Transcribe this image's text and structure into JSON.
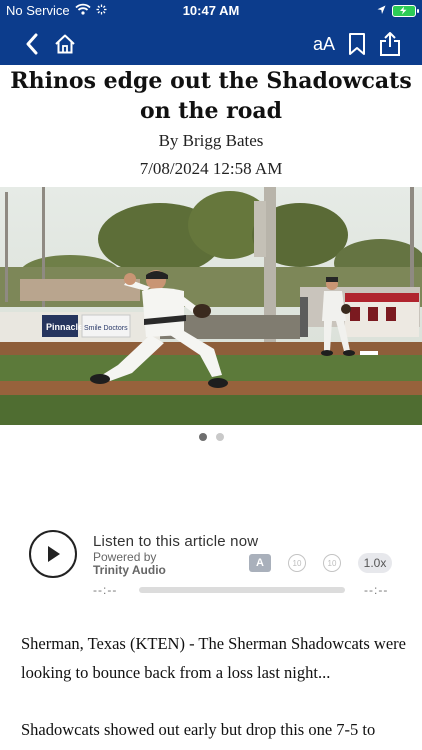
{
  "status_bar": {
    "carrier": "No Service",
    "time": "10:47 AM",
    "battery_color": "#2dcc56"
  },
  "nav": {
    "background": "#0c3c8c",
    "back_icon": "chevron-left-icon",
    "home_icon": "home-icon",
    "text_size_label": "aA",
    "bookmark_icon": "bookmark-icon",
    "share_icon": "share-icon"
  },
  "article": {
    "headline": "Rhinos edge out the Shadowcats on the road",
    "byline": "By Brigg Bates",
    "dateline": "7/08/2024 12:58 AM",
    "paragraphs": [
      "Sherman, Texas (KTEN) - The Sherman Shadowcats were looking to bounce back from a loss last night...",
      "Shadowcats showed out early but drop this one 7-5 to"
    ]
  },
  "gallery": {
    "banner_signs": [
      "Pinnacle",
      "Smile Doctors"
    ],
    "page_count": 2,
    "current_page": 1
  },
  "audio_player": {
    "listen_label": "Listen to this article now",
    "powered_by_label": "Powered by",
    "provider_name": "Trinity Audio",
    "translate_label": "A",
    "rewind_label": "10",
    "forward_label": "10",
    "speed_label": "1.0x",
    "elapsed_time": "--:--",
    "remaining_time": "--:--",
    "progress": 0
  }
}
